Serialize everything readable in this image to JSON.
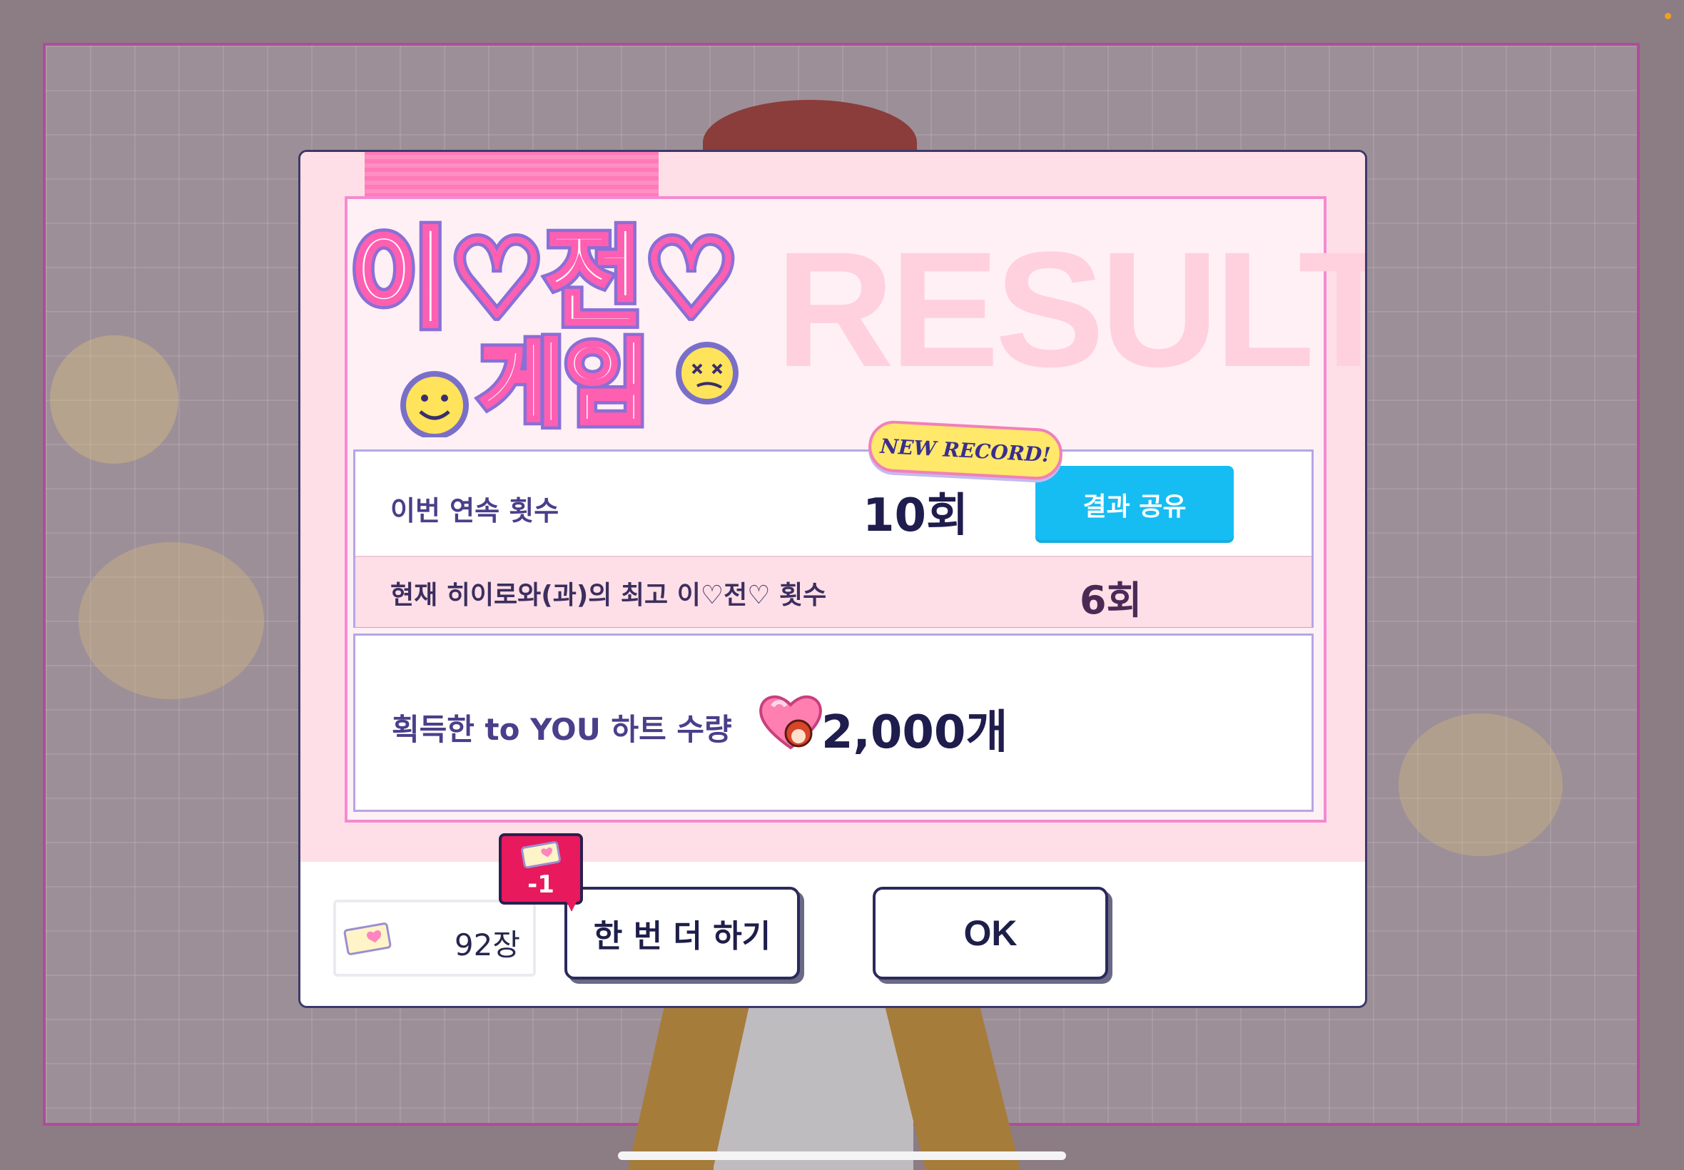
{
  "logo": {
    "title_line1": "이♡전♡",
    "title_line2": "게임"
  },
  "header": {
    "result_watermark": "RESULT"
  },
  "badge": {
    "new_record": "NEW RECORD!"
  },
  "streak": {
    "label": "이번 연속 횟수",
    "value": "10회",
    "share_button": "결과 공유"
  },
  "best": {
    "label": "현재 히이로와(과)의 최고 이♡전♡ 횟수",
    "value": "6회"
  },
  "reward": {
    "label": "획득한 to YOU 하트 수량",
    "value": "2,000개"
  },
  "tickets": {
    "count": "92장",
    "cost": "-1"
  },
  "buttons": {
    "retry": "한 번 더 하기",
    "ok": "OK"
  },
  "colors": {
    "accent_blue": "#16bdf3",
    "pink_panel": "#ffdfe7",
    "frame_pink": "#f58ad0",
    "badge_red": "#e8195c",
    "text_navy": "#1f1d4d"
  }
}
